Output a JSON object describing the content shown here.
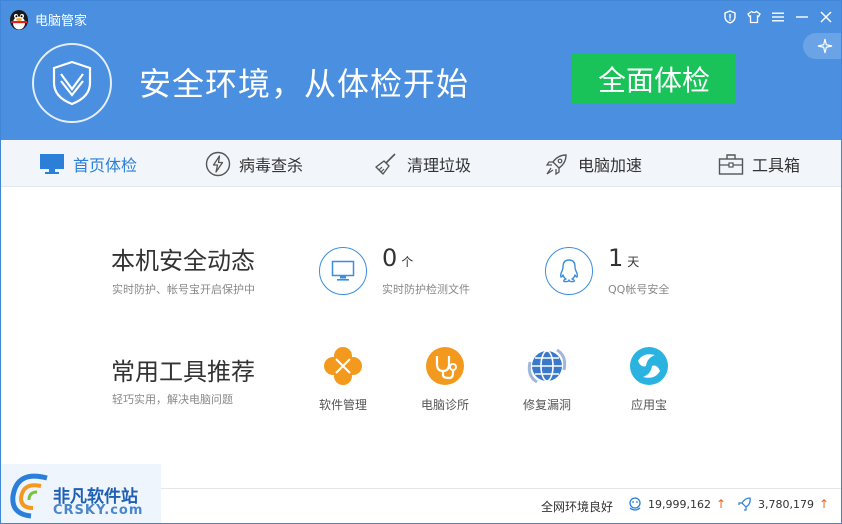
{
  "app": {
    "title": "电脑管家"
  },
  "banner": {
    "slogan": "安全环境，从体检开始",
    "scan_button": "全面体检"
  },
  "nav": {
    "items": [
      {
        "label": "首页体检",
        "icon": "monitor-icon",
        "active": true
      },
      {
        "label": "病毒查杀",
        "icon": "lightning-icon"
      },
      {
        "label": "清理垃圾",
        "icon": "broom-icon"
      },
      {
        "label": "电脑加速",
        "icon": "rocket-icon"
      },
      {
        "label": "工具箱",
        "icon": "toolbox-icon"
      }
    ]
  },
  "security": {
    "title": "本机安全动态",
    "subtitle": "实时防护、帐号宝开启保护中",
    "stats": [
      {
        "value": "0",
        "unit": "个",
        "label": "实时防护检测文件",
        "icon": "monitor-icon"
      },
      {
        "value": "1",
        "unit": "天",
        "label": "QQ帐号安全",
        "icon": "qq-penguin-icon"
      }
    ]
  },
  "tools": {
    "title": "常用工具推荐",
    "subtitle": "轻巧实用，解决电脑问题",
    "items": [
      {
        "label": "软件管理",
        "icon": "clover-icon",
        "color": "#f39a1e"
      },
      {
        "label": "电脑诊所",
        "icon": "stethoscope-icon",
        "color": "#f39a1e"
      },
      {
        "label": "修复漏洞",
        "icon": "repair-globe-icon",
        "color": "#3a78c8"
      },
      {
        "label": "应用宝",
        "icon": "app-store-icon",
        "color": "#2ab3e0"
      }
    ]
  },
  "footer": {
    "status": "全网环境良好",
    "stat1": "19,999,162",
    "stat2": "3,780,179"
  },
  "watermark": {
    "text": "非凡软件站",
    "sub": "CRSKY.com"
  },
  "colors": {
    "header_blue": "#4a8fe0",
    "scan_green": "#1ac35a",
    "accent_blue": "#2b7fd9",
    "orange": "#f39a1e"
  }
}
